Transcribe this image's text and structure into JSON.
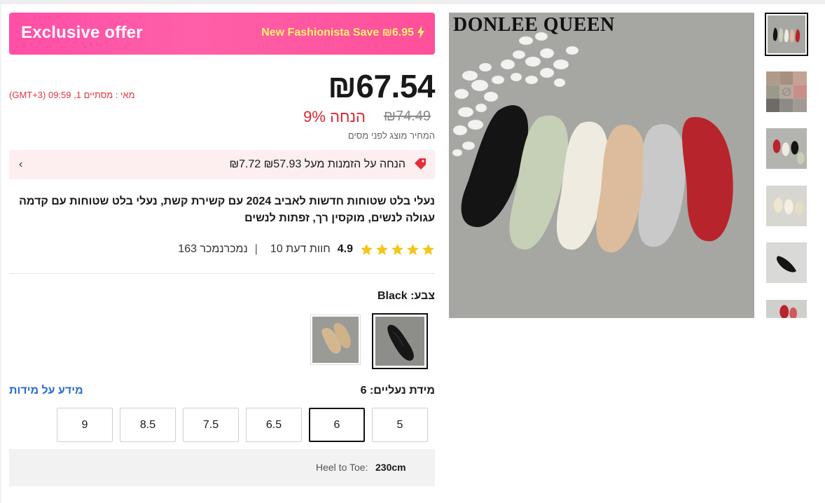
{
  "banner": {
    "title": "Exclusive offer",
    "promo": "New Fashionista Save ₪6.95"
  },
  "price": {
    "current": "₪67.54",
    "ends": "(GMT+3) 09:59 ,1 מאי : מסתיים",
    "discount": "9% הנחה",
    "original": "₪74.49",
    "tax_note": "המחיר מוצג לפני מסים"
  },
  "coupon": {
    "text": "₪7.72 הנחה על הזמנות מעל ₪57.93"
  },
  "product": {
    "title": "נעלי בלט שטוחות חדשות לאביב 2024 עם קשירת קשת, נעלי בלט שטוחות עם קדמה עגולה לנשים, מוקסין רך, זפתות לנשים"
  },
  "rating": {
    "score": "4.9",
    "reviews": "10 חוות דעת",
    "sold": "163 נמכרנמכר",
    "stars": 5,
    "star_color": "#f5c518"
  },
  "color": {
    "label": "צבע: Black",
    "options": [
      "black",
      "beige"
    ],
    "selected": "black"
  },
  "size": {
    "label": "מידת נעליים: 6",
    "info_link": "מידע על מידות",
    "options": [
      "5",
      "6",
      "6.5",
      "7.5",
      "8.5",
      "9"
    ],
    "selected": "6"
  },
  "heel_to_toe": {
    "label": "Heel to Toe:",
    "value": "230cm"
  },
  "gallery": {
    "brand": "DONLEE QUEEN",
    "thumbnails": 6,
    "selected": 0
  },
  "colors": {
    "banner": "#ff4fa6",
    "promo_text": "#fff36a",
    "price_red": "#d9262e",
    "link_blue": "#2a6ccf"
  }
}
